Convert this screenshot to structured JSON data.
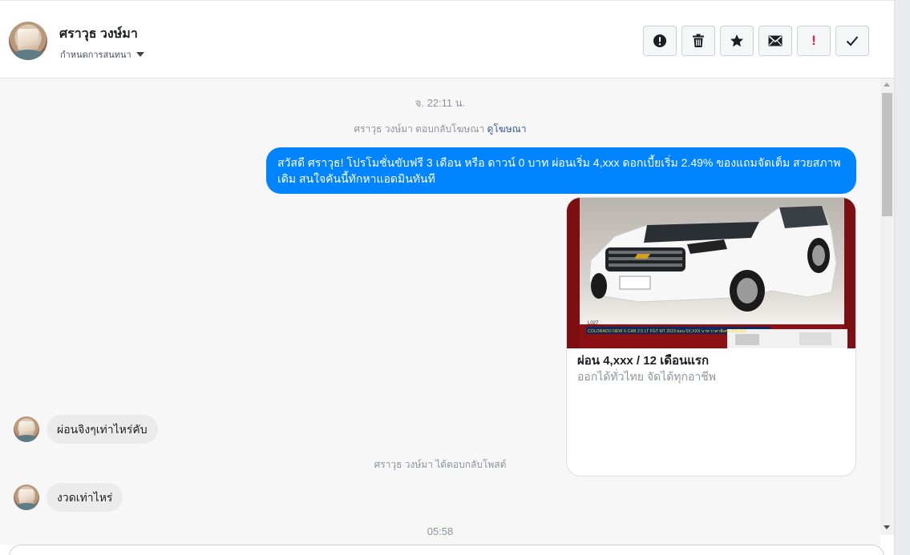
{
  "header": {
    "contact_name": "ศราวุธ วงษ์มา",
    "assign_label": "กำหนดการสนทนา",
    "toolbar": [
      {
        "name": "spam-button",
        "icon": "alert-circle-icon"
      },
      {
        "name": "delete-button",
        "icon": "trash-icon"
      },
      {
        "name": "star-button",
        "icon": "star-icon"
      },
      {
        "name": "mark-unread-button",
        "icon": "envelope-icon"
      },
      {
        "name": "follow-up-button",
        "icon": "exclamation-icon",
        "glyph": "!"
      },
      {
        "name": "mark-done-button",
        "icon": "checkmark-icon"
      }
    ]
  },
  "conversation": {
    "timestamp_1": "จ. 22:11 น.",
    "ad_reply_text": "ศราวุธ วงษ์มา ตอบกลับโฆษณา",
    "ad_reply_link": "ดูโฆษณา",
    "outgoing_message": "สวัสดี ศราวุธ! โปรโมชั่นขับฟรี 3 เดือน หรือ ดาวน์ 0 บาท ผ่อนเริ่ม 4,xxx ดอกเบี้ยเริ่ม 2.49% ของแถมจัดเต็ม สวยสภาพเดิม สนใจคันนี้ทักหาแอดมินทันที",
    "card": {
      "image_caption": "COLORADO NEW X-CAB 2.5 LT FGT MT 2019 ผ่อน 5X,XXX บาท ราคาพิเศษ 359,000",
      "image_code": "L027",
      "title": "ผ่อน 4,xxx / 12 เดือนแรก",
      "subtitle": "ออกได้ทั่วไทย จัดได้ทุกอาชีพ"
    },
    "incoming_1": "ผ่อนจิงๆเท่าไหร่คับ",
    "post_reply_text": "ศราวุธ วงษ์มา ได้ตอบกลับโพสต์",
    "incoming_2": "งวดเท่าไหร่",
    "timestamp_2": "05:58"
  },
  "colors": {
    "outgoing_bubble": "#0084ff",
    "incoming_bubble": "#ebebeb",
    "follow_up_red": "#e41e3f",
    "link_blue": "#385898"
  }
}
